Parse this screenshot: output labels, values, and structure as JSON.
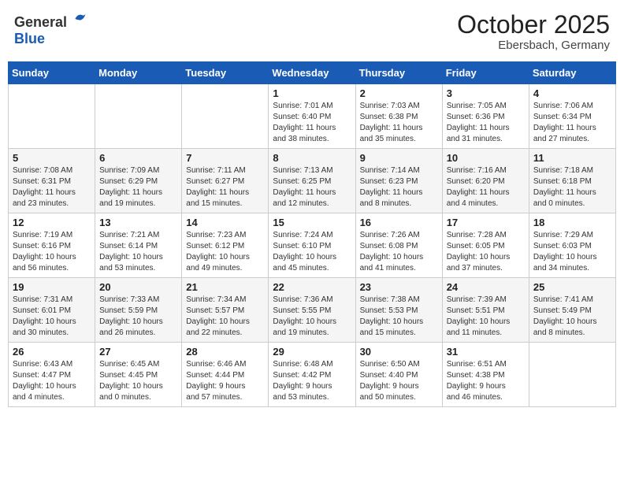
{
  "header": {
    "logo": {
      "general": "General",
      "blue": "Blue"
    },
    "title": "October 2025",
    "location": "Ebersbach, Germany"
  },
  "calendar": {
    "weekdays": [
      "Sunday",
      "Monday",
      "Tuesday",
      "Wednesday",
      "Thursday",
      "Friday",
      "Saturday"
    ],
    "weeks": [
      [
        {
          "day": null,
          "info": null
        },
        {
          "day": null,
          "info": null
        },
        {
          "day": null,
          "info": null
        },
        {
          "day": "1",
          "info": "Sunrise: 7:01 AM\nSunset: 6:40 PM\nDaylight: 11 hours\nand 38 minutes."
        },
        {
          "day": "2",
          "info": "Sunrise: 7:03 AM\nSunset: 6:38 PM\nDaylight: 11 hours\nand 35 minutes."
        },
        {
          "day": "3",
          "info": "Sunrise: 7:05 AM\nSunset: 6:36 PM\nDaylight: 11 hours\nand 31 minutes."
        },
        {
          "day": "4",
          "info": "Sunrise: 7:06 AM\nSunset: 6:34 PM\nDaylight: 11 hours\nand 27 minutes."
        }
      ],
      [
        {
          "day": "5",
          "info": "Sunrise: 7:08 AM\nSunset: 6:31 PM\nDaylight: 11 hours\nand 23 minutes."
        },
        {
          "day": "6",
          "info": "Sunrise: 7:09 AM\nSunset: 6:29 PM\nDaylight: 11 hours\nand 19 minutes."
        },
        {
          "day": "7",
          "info": "Sunrise: 7:11 AM\nSunset: 6:27 PM\nDaylight: 11 hours\nand 15 minutes."
        },
        {
          "day": "8",
          "info": "Sunrise: 7:13 AM\nSunset: 6:25 PM\nDaylight: 11 hours\nand 12 minutes."
        },
        {
          "day": "9",
          "info": "Sunrise: 7:14 AM\nSunset: 6:23 PM\nDaylight: 11 hours\nand 8 minutes."
        },
        {
          "day": "10",
          "info": "Sunrise: 7:16 AM\nSunset: 6:20 PM\nDaylight: 11 hours\nand 4 minutes."
        },
        {
          "day": "11",
          "info": "Sunrise: 7:18 AM\nSunset: 6:18 PM\nDaylight: 11 hours\nand 0 minutes."
        }
      ],
      [
        {
          "day": "12",
          "info": "Sunrise: 7:19 AM\nSunset: 6:16 PM\nDaylight: 10 hours\nand 56 minutes."
        },
        {
          "day": "13",
          "info": "Sunrise: 7:21 AM\nSunset: 6:14 PM\nDaylight: 10 hours\nand 53 minutes."
        },
        {
          "day": "14",
          "info": "Sunrise: 7:23 AM\nSunset: 6:12 PM\nDaylight: 10 hours\nand 49 minutes."
        },
        {
          "day": "15",
          "info": "Sunrise: 7:24 AM\nSunset: 6:10 PM\nDaylight: 10 hours\nand 45 minutes."
        },
        {
          "day": "16",
          "info": "Sunrise: 7:26 AM\nSunset: 6:08 PM\nDaylight: 10 hours\nand 41 minutes."
        },
        {
          "day": "17",
          "info": "Sunrise: 7:28 AM\nSunset: 6:05 PM\nDaylight: 10 hours\nand 37 minutes."
        },
        {
          "day": "18",
          "info": "Sunrise: 7:29 AM\nSunset: 6:03 PM\nDaylight: 10 hours\nand 34 minutes."
        }
      ],
      [
        {
          "day": "19",
          "info": "Sunrise: 7:31 AM\nSunset: 6:01 PM\nDaylight: 10 hours\nand 30 minutes."
        },
        {
          "day": "20",
          "info": "Sunrise: 7:33 AM\nSunset: 5:59 PM\nDaylight: 10 hours\nand 26 minutes."
        },
        {
          "day": "21",
          "info": "Sunrise: 7:34 AM\nSunset: 5:57 PM\nDaylight: 10 hours\nand 22 minutes."
        },
        {
          "day": "22",
          "info": "Sunrise: 7:36 AM\nSunset: 5:55 PM\nDaylight: 10 hours\nand 19 minutes."
        },
        {
          "day": "23",
          "info": "Sunrise: 7:38 AM\nSunset: 5:53 PM\nDaylight: 10 hours\nand 15 minutes."
        },
        {
          "day": "24",
          "info": "Sunrise: 7:39 AM\nSunset: 5:51 PM\nDaylight: 10 hours\nand 11 minutes."
        },
        {
          "day": "25",
          "info": "Sunrise: 7:41 AM\nSunset: 5:49 PM\nDaylight: 10 hours\nand 8 minutes."
        }
      ],
      [
        {
          "day": "26",
          "info": "Sunrise: 6:43 AM\nSunset: 4:47 PM\nDaylight: 10 hours\nand 4 minutes."
        },
        {
          "day": "27",
          "info": "Sunrise: 6:45 AM\nSunset: 4:45 PM\nDaylight: 10 hours\nand 0 minutes."
        },
        {
          "day": "28",
          "info": "Sunrise: 6:46 AM\nSunset: 4:44 PM\nDaylight: 9 hours\nand 57 minutes."
        },
        {
          "day": "29",
          "info": "Sunrise: 6:48 AM\nSunset: 4:42 PM\nDaylight: 9 hours\nand 53 minutes."
        },
        {
          "day": "30",
          "info": "Sunrise: 6:50 AM\nSunset: 4:40 PM\nDaylight: 9 hours\nand 50 minutes."
        },
        {
          "day": "31",
          "info": "Sunrise: 6:51 AM\nSunset: 4:38 PM\nDaylight: 9 hours\nand 46 minutes."
        },
        {
          "day": null,
          "info": null
        }
      ]
    ]
  }
}
